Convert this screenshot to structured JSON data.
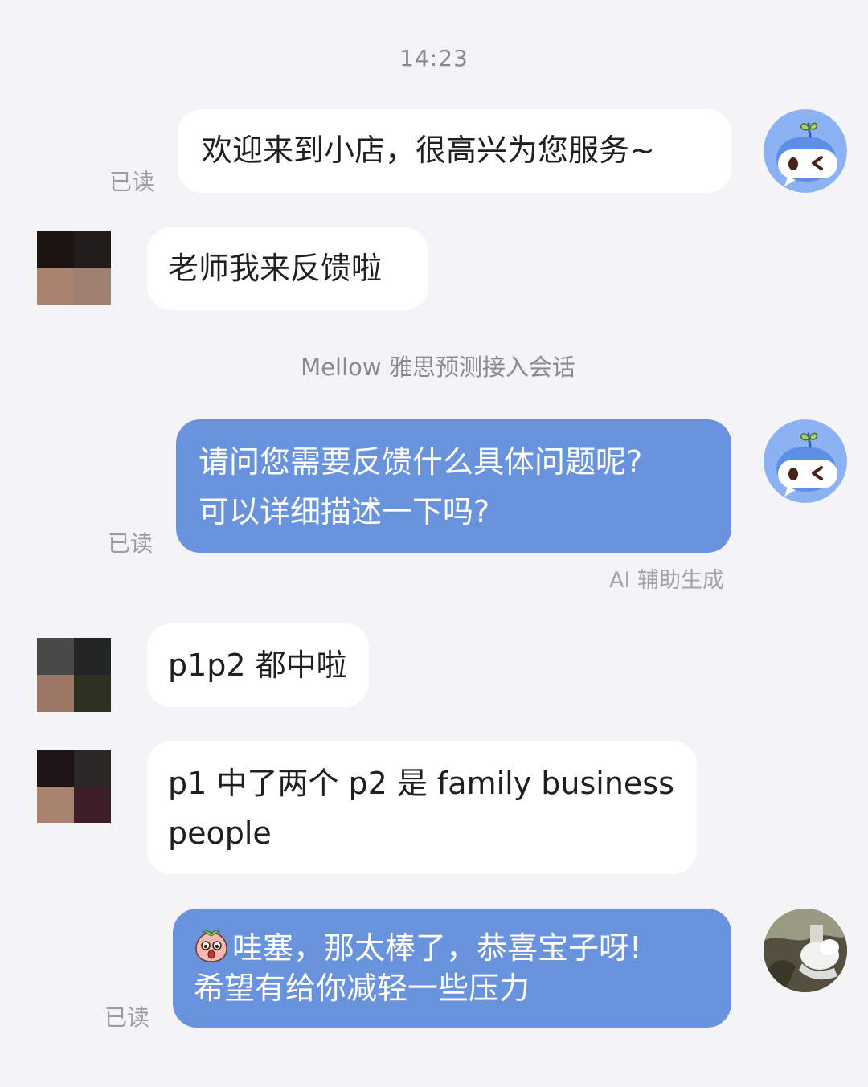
{
  "chat": {
    "timestamp": "14:23",
    "system_note": "Mellow 雅思预测接入会话",
    "read_label": "已读",
    "ai_note": "AI 辅助生成",
    "messages": [
      {
        "sender": "shop",
        "text": "欢迎来到小店，很高兴为您服务~",
        "read": true
      },
      {
        "sender": "user",
        "text": "老师我来反馈啦"
      },
      {
        "sender": "shop",
        "line1": "请问您需要反馈什么具体问题呢?",
        "line2": "可以详细描述一下吗?",
        "read": true,
        "ai": true
      },
      {
        "sender": "user",
        "text": "p1p2 都中啦"
      },
      {
        "sender": "user",
        "line1": "p1 中了两个 p2 是 family business",
        "line2": "people"
      },
      {
        "sender": "shop",
        "line1": "哇塞，那太棒了，恭喜宝子呀!",
        "line2": "希望有给你减轻一些压力",
        "emoji": "peach-face-icon",
        "read": true
      }
    ]
  },
  "colors": {
    "background": "#f4f4f6",
    "bubble_incoming": "#ffffff",
    "bubble_outgoing": "#6a93de",
    "meta_text": "#8a8a8e"
  },
  "icons": [
    "bot-mascot-avatar",
    "user-avatar-pixelated",
    "agent-photo-avatar",
    "peach-face-icon"
  ]
}
